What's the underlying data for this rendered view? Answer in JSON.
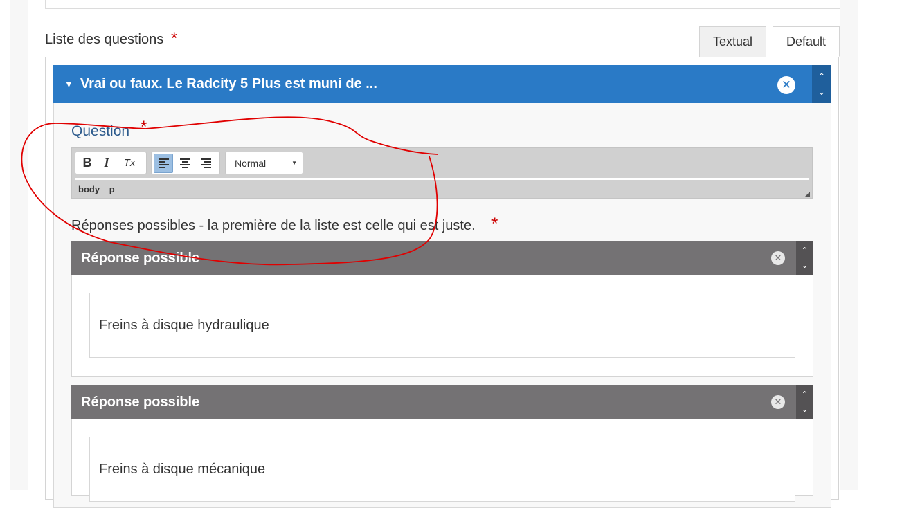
{
  "list": {
    "label": "Liste des questions",
    "required_mark": "*",
    "tabs": [
      {
        "label": "Textual",
        "active": false
      },
      {
        "label": "Default",
        "active": true
      }
    ]
  },
  "question_item": {
    "caret": "▼",
    "title": "Vrai ou faux. Le Radcity 5 Plus est muni de ...",
    "remove_icon": "✕",
    "move_up": "⌃",
    "move_down": "⌄",
    "header_color": "#2a7ac6"
  },
  "question_field": {
    "label": "Question",
    "required_mark": "*",
    "toolbar": {
      "bold": "B",
      "italic": "I",
      "clear_format": "Tx",
      "format_value": "Normal",
      "align_left_active": true
    },
    "path": [
      "body",
      "p"
    ]
  },
  "answers": {
    "label": "Réponses possibles - la première de la liste est celle qui est juste.",
    "required_mark": "*",
    "items": [
      {
        "header": "Réponse possible",
        "value": "Freins à disque hydraulique"
      },
      {
        "header": "Réponse possible",
        "value": "Freins à disque mécanique"
      }
    ],
    "header_color": "#747274"
  },
  "annotation": {
    "color": "#e00000",
    "shape": "hand-drawn circle around Question editor"
  }
}
